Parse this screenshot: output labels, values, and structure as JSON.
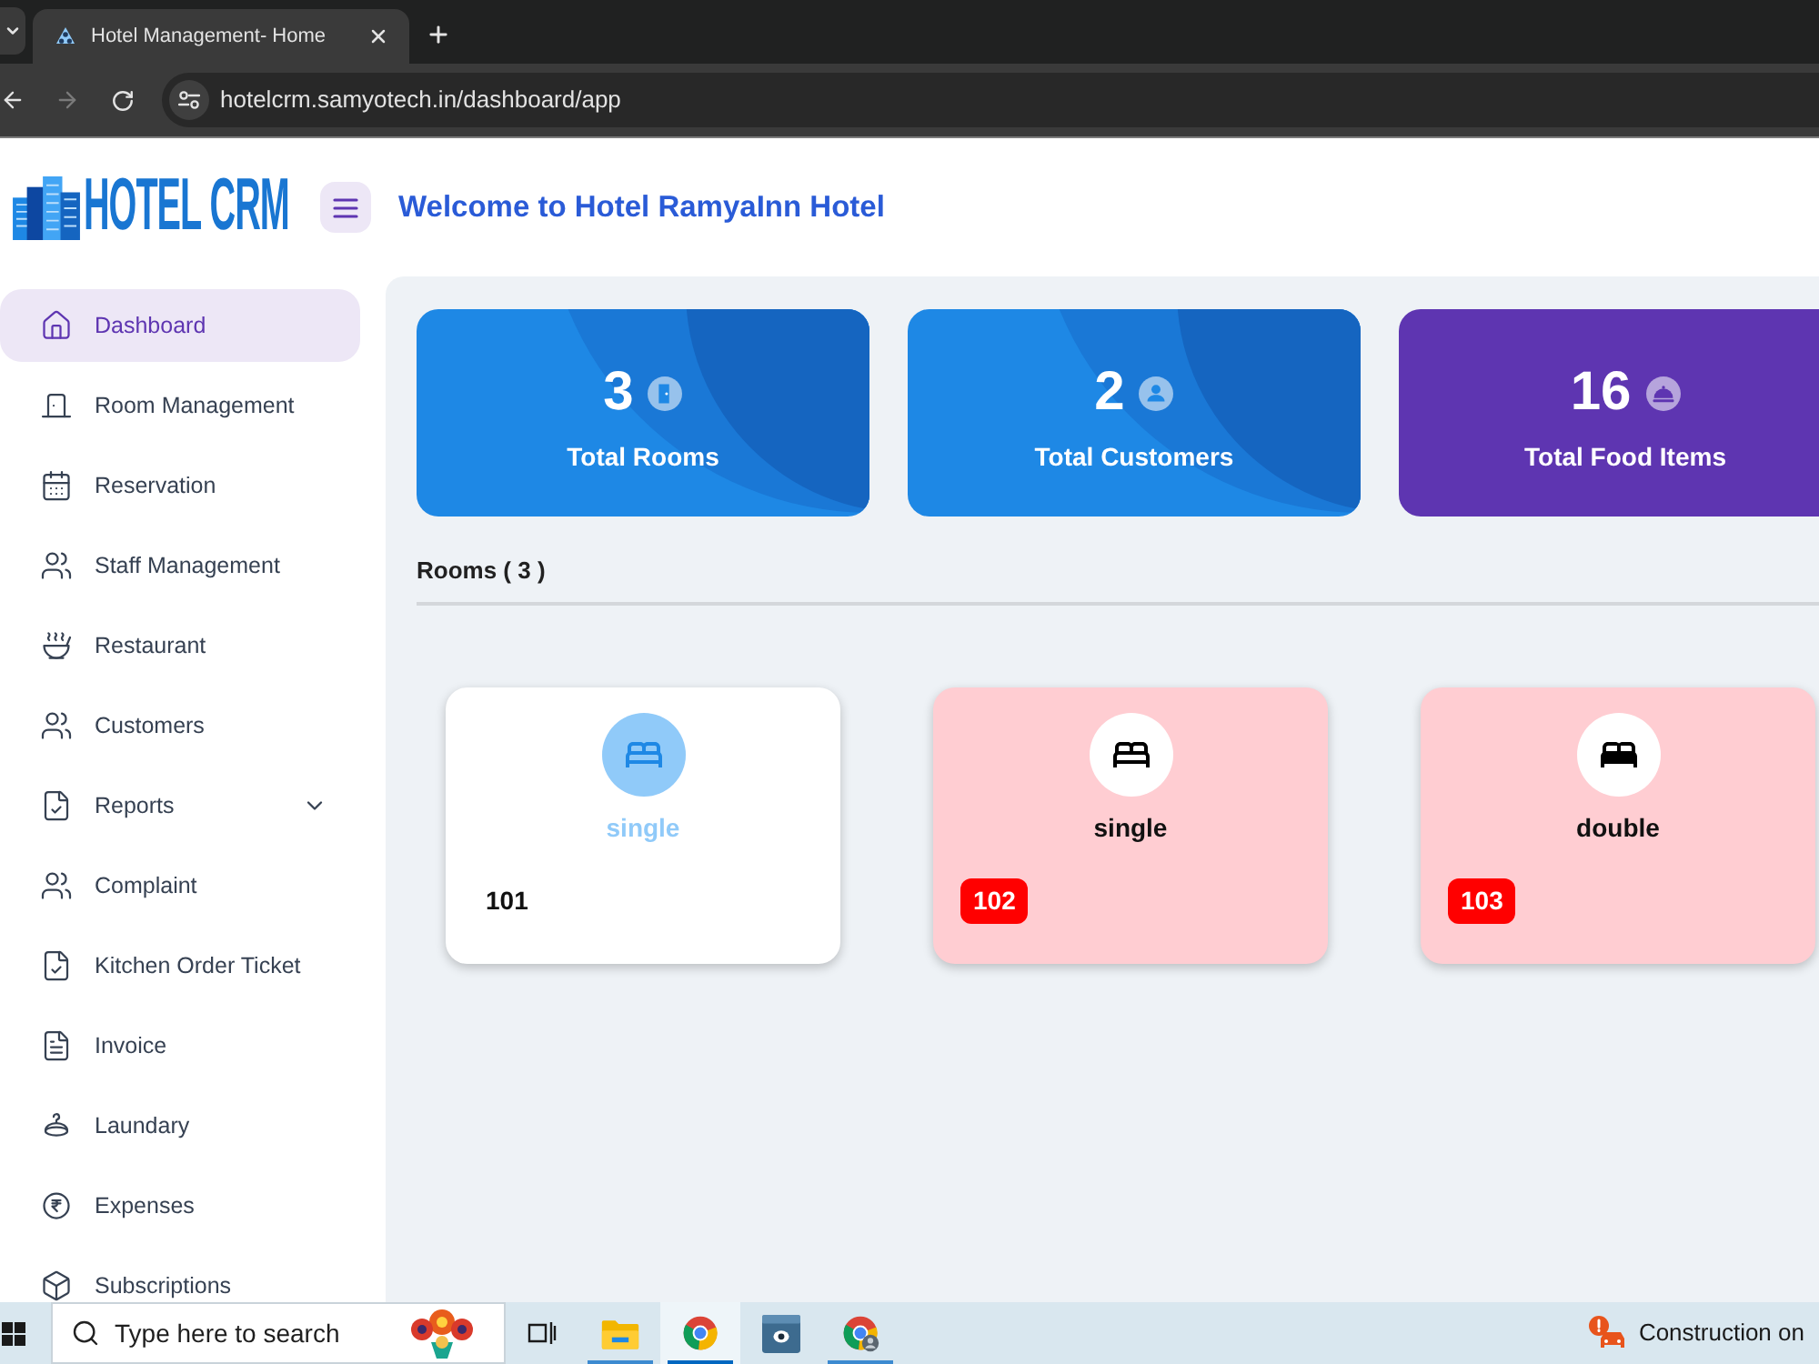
{
  "browser": {
    "tabs": [
      {
        "title": "Hotel Management- Home",
        "selected": true
      }
    ],
    "url": "hotelcrm.samyotech.in/dashboard/app"
  },
  "header": {
    "logo": "HOTEL CRM",
    "title": "Welcome to Hotel RamyaInn Hotel"
  },
  "sidebar": {
    "items": [
      {
        "label": "Dashboard",
        "selected": true,
        "submenu": false
      },
      {
        "label": "Room Management",
        "selected": false,
        "submenu": false
      },
      {
        "label": "Reservation",
        "selected": false,
        "submenu": false
      },
      {
        "label": "Staff Management",
        "selected": false,
        "submenu": false
      },
      {
        "label": "Restaurant",
        "selected": false,
        "submenu": false
      },
      {
        "label": "Customers",
        "selected": false,
        "submenu": false
      },
      {
        "label": "Reports",
        "selected": false,
        "submenu": true
      },
      {
        "label": "Complaint",
        "selected": false,
        "submenu": false
      },
      {
        "label": "Kitchen Order Ticket",
        "selected": false,
        "submenu": false
      },
      {
        "label": "Invoice",
        "selected": false,
        "submenu": false
      },
      {
        "label": "Laundary",
        "selected": false,
        "submenu": false
      },
      {
        "label": "Expenses",
        "selected": false,
        "submenu": false
      },
      {
        "label": "Subscriptions",
        "selected": false,
        "submenu": false
      }
    ]
  },
  "stats": [
    {
      "value": "3",
      "label": "Total Rooms",
      "color": "#1e88e5",
      "kind": "waves"
    },
    {
      "value": "2",
      "label": "Total Customers",
      "color": "#1e88e5",
      "kind": "waves"
    },
    {
      "value": "16",
      "label": "Total Food Items",
      "color": "#5e35b1",
      "kind": "plain"
    }
  ],
  "rooms": {
    "title": "Rooms ( 3 )",
    "items": [
      {
        "type": "single",
        "number": "101",
        "occupied": false,
        "kind": "single"
      },
      {
        "type": "single",
        "number": "102",
        "occupied": true,
        "kind": "single"
      },
      {
        "type": "double",
        "number": "103",
        "occupied": true,
        "kind": "double"
      }
    ]
  },
  "taskbar": {
    "search": {
      "placeholder": "Type here to search"
    },
    "apps": [
      {
        "running": true,
        "selected": false
      },
      {
        "running": true,
        "selected": true
      },
      {
        "running": false,
        "selected": false
      },
      {
        "running": true,
        "selected": false
      }
    ],
    "notification": "Construction on"
  }
}
